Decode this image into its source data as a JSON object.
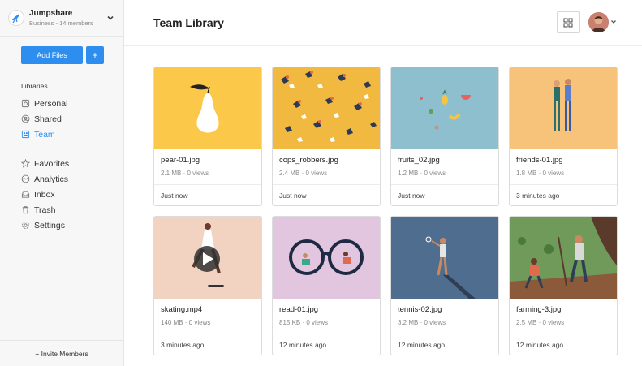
{
  "org": {
    "name": "Jumpshare",
    "subtitle": "Business - 14 members"
  },
  "actions": {
    "add_files": "Add Files",
    "add_plus": "+"
  },
  "sidebar": {
    "libraries_heading": "Libraries",
    "libraries": [
      {
        "label": "Personal",
        "icon": "home-icon"
      },
      {
        "label": "Shared",
        "icon": "shared-icon"
      },
      {
        "label": "Team",
        "icon": "team-icon",
        "active": true
      }
    ],
    "items": [
      {
        "label": "Favorites",
        "icon": "star-icon"
      },
      {
        "label": "Analytics",
        "icon": "analytics-icon"
      },
      {
        "label": "Inbox",
        "icon": "inbox-icon"
      },
      {
        "label": "Trash",
        "icon": "trash-icon"
      },
      {
        "label": "Settings",
        "icon": "gear-icon"
      }
    ],
    "invite": "+ Invite Members"
  },
  "header": {
    "title": "Team Library"
  },
  "colors": {
    "accent": "#2e8ef0"
  },
  "files": [
    {
      "name": "pear-01.jpg",
      "meta": "2.1 MB · 0 views",
      "time": "Just now"
    },
    {
      "name": "cops_robbers.jpg",
      "meta": "2.4 MB · 0 views",
      "time": "Just now"
    },
    {
      "name": "fruits_02.jpg",
      "meta": "1.2 MB · 0 views",
      "time": "Just now"
    },
    {
      "name": "friends-01.jpg",
      "meta": "1.8 MB · 0 views",
      "time": "3 minutes ago"
    },
    {
      "name": "skating.mp4",
      "meta": "140 MB · 0 views",
      "time": "3 minutes ago"
    },
    {
      "name": "read-01.jpg",
      "meta": "815 KB · 0 views",
      "time": "12 minutes ago"
    },
    {
      "name": "tennis-02.jpg",
      "meta": "3.2 MB · 0 views",
      "time": "12 minutes ago"
    },
    {
      "name": "farming-3.jpg",
      "meta": "2.5 MB · 0 views",
      "time": "12 minutes ago"
    }
  ]
}
